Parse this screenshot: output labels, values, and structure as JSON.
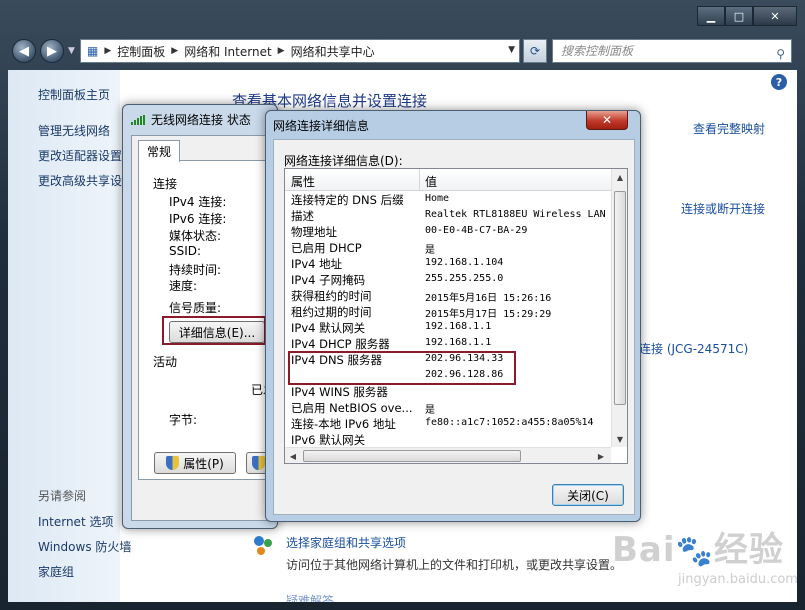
{
  "explorer": {
    "breadcrumbs": [
      "控制面板",
      "网络和 Internet",
      "网络和共享中心"
    ],
    "search_placeholder": "搜索控制面板",
    "left_pane": {
      "home": "控制面板主页",
      "items": [
        "管理无线网络",
        "更改适配器设置",
        "更改高级共享设"
      ],
      "see_also_header": "另请参阅",
      "see_also": [
        "Internet 选项",
        "Windows 防火墙",
        "家庭组"
      ]
    },
    "main": {
      "title": "查看基本网络信息并设置连接",
      "full_map_link": "查看完整映射",
      "connect_disconnect_link": "连接或断开连接",
      "connection_link": "连接 (JCG-24571C)",
      "homegroup_link": "选择家庭组和共享选项",
      "homegroup_desc": "访问位于其他网络计算机上的文件和打印机，或更改共享设置。",
      "last_link": "疑难解答"
    }
  },
  "status_dialog": {
    "title": "无线网络连接 状态",
    "tab": "常规",
    "section_connection": "连接",
    "labels": [
      "IPv4 连接:",
      "IPv6 连接:",
      "媒体状态:",
      "SSID:",
      "持续时间:",
      "速度:"
    ],
    "signal_label": "信号质量:",
    "details_button": "详细信息(E)...",
    "section_activity": "活动",
    "sent_partial": "已发",
    "bytes_label": "字节:",
    "properties_button": "属性(P)",
    "disable_button_partial": ""
  },
  "details_dialog": {
    "title": "网络连接详细信息",
    "list_label": "网络连接详细信息(D):",
    "columns": [
      "属性",
      "值"
    ],
    "rows": [
      {
        "prop": "连接特定的 DNS 后缀",
        "val": "Home"
      },
      {
        "prop": "描述",
        "val": "Realtek RTL8188EU Wireless LAN"
      },
      {
        "prop": "物理地址",
        "val": "00-E0-4B-C7-BA-29"
      },
      {
        "prop": "已启用 DHCP",
        "val": "是"
      },
      {
        "prop": "IPv4 地址",
        "val": "192.168.1.104"
      },
      {
        "prop": "IPv4 子网掩码",
        "val": "255.255.255.0"
      },
      {
        "prop": "获得租约的时间",
        "val": "2015年5月16日 15:26:16"
      },
      {
        "prop": "租约过期的时间",
        "val": "2015年5月17日 15:29:29"
      },
      {
        "prop": "IPv4 默认网关",
        "val": "192.168.1.1"
      },
      {
        "prop": "IPv4 DHCP 服务器",
        "val": "192.168.1.1"
      },
      {
        "prop": "IPv4 DNS 服务器",
        "val": "202.96.134.33"
      },
      {
        "prop": "",
        "val": "202.96.128.86"
      },
      {
        "prop": "IPv4 WINS 服务器",
        "val": ""
      },
      {
        "prop": "已启用 NetBIOS ove...",
        "val": "是"
      },
      {
        "prop": "连接-本地 IPv6 地址",
        "val": "fe80::a1c7:1052:a455:8a05%14"
      },
      {
        "prop": "IPv6 默认网关",
        "val": ""
      }
    ],
    "close_button": "关闭(C)"
  },
  "watermark": {
    "text": "Baidu经验",
    "sub": "jingyan.baidu.com"
  }
}
